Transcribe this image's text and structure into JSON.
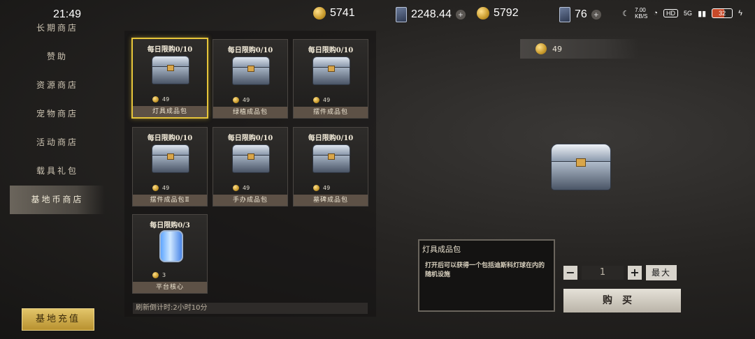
{
  "status": {
    "time": "21:49",
    "net_speed": "7.00",
    "net_unit": "KB/S",
    "hd": "HD",
    "signal": "5G",
    "battery": "32"
  },
  "currency": {
    "coin_a": "5741",
    "card_value": "2248.44",
    "coin_b": "5792",
    "card_count": "76"
  },
  "sidebar": {
    "items": [
      {
        "label": "长期商店"
      },
      {
        "label": "赞助"
      },
      {
        "label": "资源商店"
      },
      {
        "label": "宠物商店"
      },
      {
        "label": "活动商店"
      },
      {
        "label": "载具礼包"
      },
      {
        "label": "基地币商店"
      }
    ],
    "active_index": 6,
    "recharge_label": "基地充值"
  },
  "shop_items": [
    {
      "limit": "每日限购0/10",
      "price": "49",
      "name": "灯具成品包",
      "icon": "silver-chest-icon"
    },
    {
      "limit": "每日限购0/10",
      "price": "49",
      "name": "绿植成品包",
      "icon": "silver-chest-icon"
    },
    {
      "limit": "每日限购0/10",
      "price": "49",
      "name": "摆件成品包",
      "icon": "silver-chest-icon"
    },
    {
      "limit": "每日限购0/10",
      "price": "49",
      "name": "摆件成品包Ⅱ",
      "icon": "silver-chest-icon"
    },
    {
      "limit": "每日限购0/10",
      "price": "49",
      "name": "手办成品包",
      "icon": "silver-chest-icon"
    },
    {
      "limit": "每日限购0/10",
      "price": "49",
      "name": "墓碑成品包",
      "icon": "silver-chest-icon"
    },
    {
      "limit": "每日限购0/3",
      "price": "3",
      "name": "平台核心",
      "icon": "blue-core-icon"
    }
  ],
  "refresh_text": "刷新倒计时:2小时10分",
  "detail": {
    "price": "49",
    "title": "灯具成品包",
    "description": "打开后可以获得一个包括迪斯科灯球在内的随机设施",
    "quantity": "1",
    "minus_label": "−",
    "plus_label": "+",
    "max_label": "最大",
    "buy_label": "购买"
  },
  "colors": {
    "selected_border": "#e6c53a",
    "recharge_gold": "#d4b04c",
    "name_bar": "#5d5146"
  }
}
